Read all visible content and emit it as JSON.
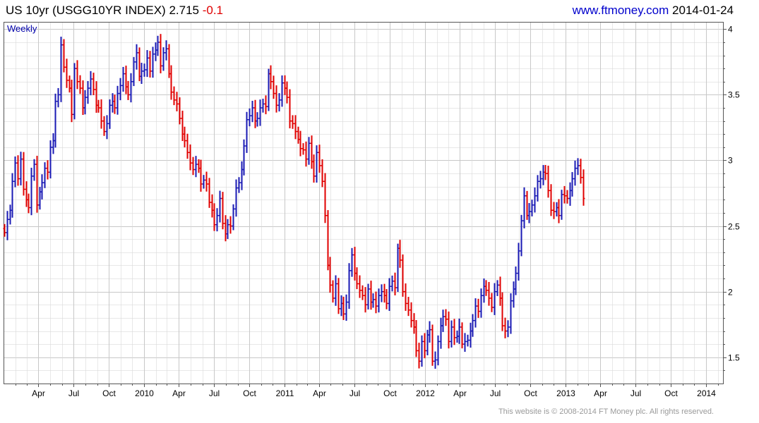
{
  "header": {
    "title_main": "US 10yr (USGG10YR INDEX) 2.715",
    "title_change": "-0.1",
    "site_url": "www.ftmoney.com",
    "site_date": "2014-01-24"
  },
  "footer": {
    "copyright": "This website is © 2008-2014 FT Money plc. All rights reserved."
  },
  "colors": {
    "up": "#1a1ab4",
    "down": "#e00000",
    "grid": "#d9d9d9",
    "frame": "#555555"
  },
  "chart_data": {
    "type": "ohlc",
    "period_label": "Weekly",
    "x_tick_labels": [
      "Apr",
      "Jul",
      "Oct",
      "2010",
      "Apr",
      "Jul",
      "Oct",
      "2011",
      "Apr",
      "Jul",
      "Oct",
      "2012",
      "Apr",
      "Jul",
      "Oct",
      "2013",
      "Apr",
      "Jul",
      "Oct",
      "2014"
    ],
    "y_tick_labels": [
      "4",
      "3.5",
      "3",
      "2.5",
      "2",
      "1.5"
    ],
    "y_ticks": [
      4,
      3.5,
      3,
      2.5,
      2,
      1.5
    ],
    "ylim": [
      1.3,
      4.05
    ],
    "xlim": [
      "2009-01-02",
      "2014-02-14"
    ],
    "grid": true,
    "x_major_ticks": [
      "2009-04-01",
      "2009-07-01",
      "2009-10-01",
      "2010-01-01",
      "2010-04-01",
      "2010-07-01",
      "2010-10-01",
      "2011-01-01",
      "2011-04-01",
      "2011-07-01",
      "2011-10-01",
      "2012-01-01",
      "2012-04-01",
      "2012-07-01",
      "2012-10-01",
      "2013-01-01",
      "2013-04-01",
      "2013-07-01",
      "2013-10-01",
      "2014-01-01"
    ],
    "series": [
      {
        "start_date": "2009-01-02",
        "interval_days": 7,
        "close": [
          2.45,
          2.55,
          2.62,
          2.84,
          2.98,
          2.86,
          3.01,
          2.78,
          2.7,
          2.64,
          2.88,
          2.97,
          2.66,
          2.76,
          2.83,
          2.94,
          2.91,
          3.1,
          3.15,
          3.45,
          3.5,
          3.88,
          3.71,
          3.61,
          3.55,
          3.35,
          3.7,
          3.6,
          3.55,
          3.4,
          3.48,
          3.55,
          3.62,
          3.54,
          3.42,
          3.4,
          3.3,
          3.22,
          3.28,
          3.42,
          3.45,
          3.4,
          3.51,
          3.57,
          3.66,
          3.56,
          3.5,
          3.6,
          3.75,
          3.82,
          3.64,
          3.68,
          3.69,
          3.78,
          3.68,
          3.81,
          3.84,
          3.9,
          3.72,
          3.82,
          3.85,
          3.66,
          3.52,
          3.46,
          3.43,
          3.32,
          3.2,
          3.15,
          3.06,
          2.98,
          2.93,
          2.97,
          2.94,
          2.82,
          2.85,
          2.82,
          2.68,
          2.62,
          2.51,
          2.58,
          2.71,
          2.52,
          2.44,
          2.51,
          2.5,
          2.63,
          2.79,
          2.83,
          2.93,
          3.11,
          3.31,
          3.34,
          3.4,
          3.3,
          3.32,
          3.4,
          3.43,
          3.41,
          3.66,
          3.6,
          3.51,
          3.42,
          3.46,
          3.59,
          3.55,
          3.48,
          3.3,
          3.28,
          3.22,
          3.16,
          3.09,
          3.08,
          3.01,
          3.13,
          2.99,
          2.88,
          3.06,
          2.96,
          2.84,
          2.58,
          2.2,
          2.05,
          1.95,
          2.06,
          1.87,
          1.91,
          1.83,
          1.92,
          2.16,
          2.28,
          2.14,
          2.06,
          2.01,
          1.97,
          1.9,
          2.02,
          1.92,
          1.94,
          1.89,
          1.97,
          2.0,
          1.97,
          1.91,
          2.04,
          2.08,
          2.03,
          2.33,
          2.24,
          2.0,
          1.91,
          1.86,
          1.78,
          1.73,
          1.55,
          1.47,
          1.62,
          1.55,
          1.67,
          1.71,
          1.47,
          1.48,
          1.62,
          1.74,
          1.81,
          1.79,
          1.62,
          1.73,
          1.65,
          1.66,
          1.73,
          1.6,
          1.62,
          1.63,
          1.7,
          1.78,
          1.89,
          1.85,
          1.97,
          2.04,
          2.01,
          1.95,
          1.88,
          2.0,
          2.05,
          1.95,
          1.74,
          1.7,
          1.73,
          1.93,
          2.02,
          2.14,
          2.31,
          2.54,
          2.73,
          2.58,
          2.61,
          2.66,
          2.73,
          2.84,
          2.86,
          2.91,
          2.9,
          2.77,
          2.62,
          2.61,
          2.64,
          2.58,
          2.74,
          2.73,
          2.71,
          2.77,
          2.86,
          2.94,
          2.96,
          2.87,
          2.71
        ]
      }
    ]
  }
}
